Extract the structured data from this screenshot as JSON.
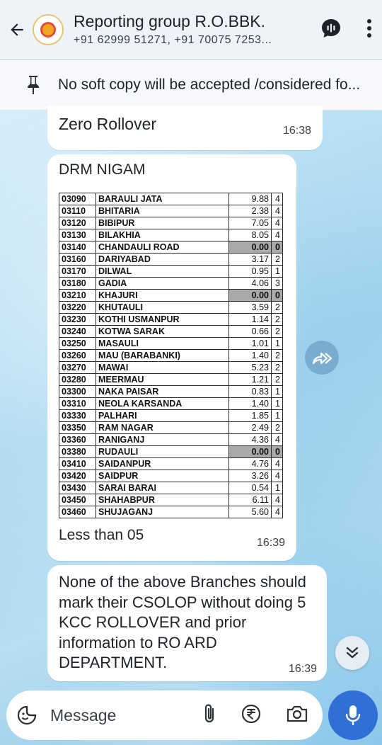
{
  "header": {
    "title": "Reporting group R.O.BBK.",
    "subtitle": "+91 62999 51271, +91 70075 7253..."
  },
  "pinned": {
    "text": "No soft copy will be accepted /considered fo..."
  },
  "messages": [
    {
      "text": "Zero Rollover",
      "time": "16:38"
    },
    {
      "sender": "DRM NIGAM",
      "caption": "Less than 05",
      "time": "16:39",
      "table_rows": [
        {
          "code": "03090",
          "name": "BARAULI JATA",
          "value": "9.88",
          "count": "4"
        },
        {
          "code": "03110",
          "name": "BHITARIA",
          "value": "2.38",
          "count": "4"
        },
        {
          "code": "03120",
          "name": "BIBIPUR",
          "value": "7.05",
          "count": "4"
        },
        {
          "code": "03130",
          "name": "BILAKHIA",
          "value": "8.05",
          "count": "4"
        },
        {
          "code": "03140",
          "name": "CHANDAULI ROAD",
          "value": "0.00",
          "count": "0"
        },
        {
          "code": "03160",
          "name": "DARIYABAD",
          "value": "3.17",
          "count": "2"
        },
        {
          "code": "03170",
          "name": "DILWAL",
          "value": "0.95",
          "count": "1"
        },
        {
          "code": "03180",
          "name": "GADIA",
          "value": "4.06",
          "count": "3"
        },
        {
          "code": "03210",
          "name": "KHAJURI",
          "value": "0.00",
          "count": "0"
        },
        {
          "code": "03220",
          "name": "KHUTAULI",
          "value": "3.59",
          "count": "2"
        },
        {
          "code": "03230",
          "name": "KOTHI USMANPUR",
          "value": "1.14",
          "count": "2"
        },
        {
          "code": "03240",
          "name": "KOTWA SARAK",
          "value": "0.66",
          "count": "2"
        },
        {
          "code": "03250",
          "name": "MASAULI",
          "value": "1.01",
          "count": "1"
        },
        {
          "code": "03260",
          "name": "MAU (BARABANKI)",
          "value": "1.40",
          "count": "2"
        },
        {
          "code": "03270",
          "name": "MAWAI",
          "value": "5.23",
          "count": "2"
        },
        {
          "code": "03280",
          "name": "MEERMAU",
          "value": "1.21",
          "count": "2"
        },
        {
          "code": "03300",
          "name": "NAKA PAISAR",
          "value": "0.83",
          "count": "1"
        },
        {
          "code": "03310",
          "name": "NEOLA KARSANDA",
          "value": "1.40",
          "count": "1"
        },
        {
          "code": "03330",
          "name": "PALHARI",
          "value": "1.85",
          "count": "1"
        },
        {
          "code": "03350",
          "name": "RAM NAGAR",
          "value": "2.49",
          "count": "2"
        },
        {
          "code": "03360",
          "name": "RANIGANJ",
          "value": "4.36",
          "count": "4"
        },
        {
          "code": "03380",
          "name": "RUDAULI",
          "value": "0.00",
          "count": "0"
        },
        {
          "code": "03410",
          "name": "SAIDANPUR",
          "value": "4.76",
          "count": "4"
        },
        {
          "code": "03420",
          "name": "SAIDPUR",
          "value": "3.26",
          "count": "4"
        },
        {
          "code": "03430",
          "name": "SARAI BARAI",
          "value": "0.54",
          "count": "1"
        },
        {
          "code": "03450",
          "name": "SHAHABPUR",
          "value": "6.11",
          "count": "4"
        },
        {
          "code": "03460",
          "name": "SHUJAGANJ",
          "value": "5.60",
          "count": "4"
        }
      ]
    },
    {
      "text": "None of the above Branches should mark their CSOLOP without doing 5 KCC ROLLOVER and prior information to RO ARD DEPARTMENT.",
      "time": "16:39"
    }
  ],
  "compose": {
    "placeholder": "Message"
  },
  "colors": {
    "header_bg": "#eef3f8",
    "mic_button": "#2f6fd6",
    "bubble_bg": "#ffffff"
  },
  "icons": [
    "back-arrow-icon",
    "group-avatar",
    "voice-call-icon",
    "more-vert-icon",
    "pin-icon",
    "forward-icon",
    "scroll-down-icon",
    "sticker-icon",
    "attach-icon",
    "rupee-payment-icon",
    "camera-icon",
    "mic-icon"
  ]
}
